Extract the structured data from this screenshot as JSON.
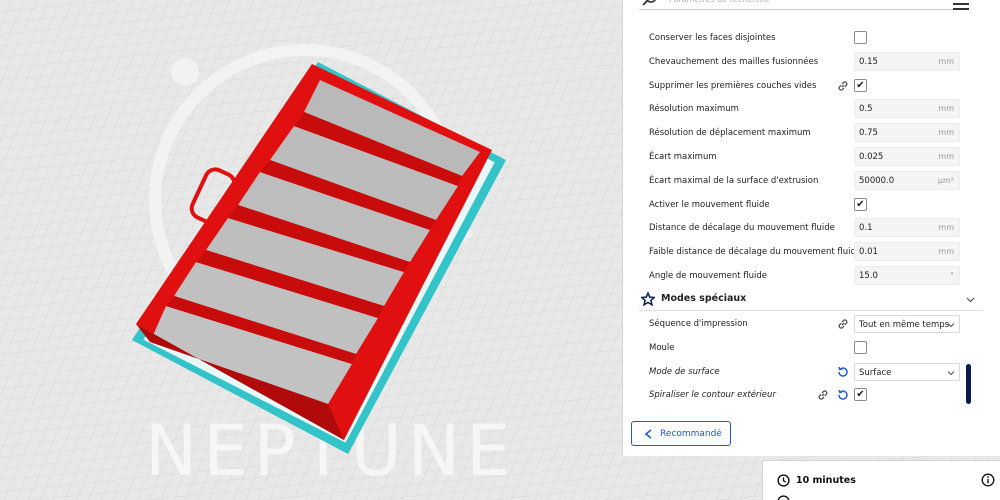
{
  "search": {
    "placeholder": "Paramètres de recherche"
  },
  "settings": [
    {
      "label": "Conserver les faces disjointes",
      "type": "checkbox",
      "checked": false
    },
    {
      "label": "Chevauchement des mailles fusionnées",
      "type": "number",
      "value": "0.15",
      "unit": "mm"
    },
    {
      "label": "Supprimer les premières couches vides",
      "type": "checkbox",
      "checked": true,
      "link": true
    },
    {
      "label": "Résolution maximum",
      "type": "number",
      "value": "0.5",
      "unit": "mm"
    },
    {
      "label": "Résolution de déplacement maximum",
      "type": "number",
      "value": "0.75",
      "unit": "mm"
    },
    {
      "label": "Écart maximum",
      "type": "number",
      "value": "0.025",
      "unit": "mm"
    },
    {
      "label": "Écart maximal de la surface d'extrusion",
      "type": "number",
      "value": "50000.0",
      "unit": "μm²"
    },
    {
      "label": "Activer le mouvement fluide",
      "type": "checkbox",
      "checked": true
    },
    {
      "label": "Distance de décalage du mouvement fluide",
      "type": "number",
      "value": "0.1",
      "unit": "mm"
    },
    {
      "label": "Faible distance de décalage du mouvement fluide",
      "type": "number",
      "value": "0.01",
      "unit": "mm"
    },
    {
      "label": "Angle de mouvement fluide",
      "type": "number",
      "value": "15.0",
      "unit": "°"
    }
  ],
  "category": {
    "title": "Modes spéciaux",
    "icon": "star-icon"
  },
  "special": [
    {
      "label": "Séquence d'impression",
      "type": "select",
      "value": "Tout en même temps",
      "link": true
    },
    {
      "label": "Moule",
      "type": "checkbox",
      "checked": false
    },
    {
      "label": "Mode de surface",
      "type": "select",
      "value": "Surface",
      "reset": true,
      "italic": true
    },
    {
      "label": "Spiraliser le contour extérieur",
      "type": "checkbox",
      "checked": true,
      "link": true,
      "reset": true,
      "italic": true
    }
  ],
  "recommend_button": {
    "label": "Recommandé"
  },
  "print_info": {
    "time": "10 minutes"
  },
  "colors": {
    "accent": "#1e59c8",
    "model_red": "#e01010",
    "support_cyan": "#33c3c8",
    "scrollbar": "#0b1a4e"
  },
  "checkmark": "✔"
}
